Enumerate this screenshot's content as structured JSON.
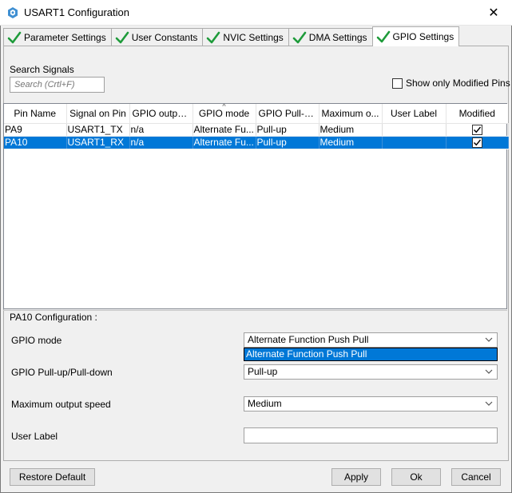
{
  "window": {
    "title": "USART1 Configuration",
    "close_glyph": "✕"
  },
  "tabs": [
    {
      "label": "Parameter Settings",
      "icon": "check-icon"
    },
    {
      "label": "User Constants",
      "icon": "check-icon"
    },
    {
      "label": "NVIC Settings",
      "icon": "check-icon"
    },
    {
      "label": "DMA Settings",
      "icon": "check-icon"
    },
    {
      "label": "GPIO Settings",
      "icon": "check-icon",
      "active": true
    }
  ],
  "search": {
    "label": "Search Signals",
    "placeholder": "Search (Crtl+F)"
  },
  "filter": {
    "show_modified_label": "Show only Modified Pins",
    "checked": false
  },
  "table": {
    "columns": [
      "Pin Name",
      "Signal on Pin",
      "GPIO output...",
      "GPIO mode",
      "GPIO Pull-u...",
      "Maximum o...",
      "User Label",
      "Modified"
    ],
    "rows": [
      {
        "pin": "PA9",
        "signal": "USART1_TX",
        "output": "n/a",
        "mode": "Alternate Fu...",
        "pull": "Pull-up",
        "speed": "Medium",
        "label": "",
        "modified": true
      },
      {
        "pin": "PA10",
        "signal": "USART1_RX",
        "output": "n/a",
        "mode": "Alternate Fu...",
        "pull": "Pull-up",
        "speed": "Medium",
        "label": "",
        "modified": true,
        "selected": true
      }
    ]
  },
  "config": {
    "title": "PA10 Configuration :",
    "gpio_mode_label": "GPIO mode",
    "gpio_mode_value": "Alternate Function Push Pull",
    "gpio_mode_option": "Alternate Function Push Pull",
    "pull_label": "GPIO Pull-up/Pull-down",
    "pull_value": "Pull-up",
    "speed_label": "Maximum output speed",
    "speed_value": "Medium",
    "user_label_label": "User Label",
    "user_label_value": ""
  },
  "buttons": {
    "restore": "Restore Default",
    "apply": "Apply",
    "ok": "Ok",
    "cancel": "Cancel"
  },
  "colors": {
    "selection": "#0078d7",
    "check_green": "#1e9b3a"
  }
}
